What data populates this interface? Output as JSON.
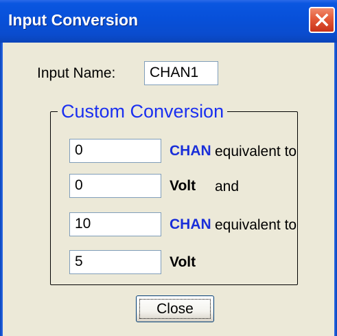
{
  "window": {
    "title": "Input Conversion"
  },
  "input_name": {
    "label": "Input Name:",
    "value": "CHAN1"
  },
  "custom_conversion": {
    "title": "Custom Conversion",
    "rows": [
      {
        "value": "0",
        "unit": "CHAN",
        "suffix": "equivalent to"
      },
      {
        "value": "0",
        "unit": "Volt",
        "suffix": "and"
      },
      {
        "value": "10",
        "unit": "CHAN",
        "suffix": "equivalent to"
      },
      {
        "value": "5",
        "unit": "Volt",
        "suffix": ""
      }
    ]
  },
  "buttons": {
    "close_label": "Close"
  },
  "colors": {
    "titlebar": "#0a4cce",
    "group_title": "#1a2ff0",
    "chan_unit": "#1a2fd9",
    "window_bg": "#ece9d8"
  }
}
